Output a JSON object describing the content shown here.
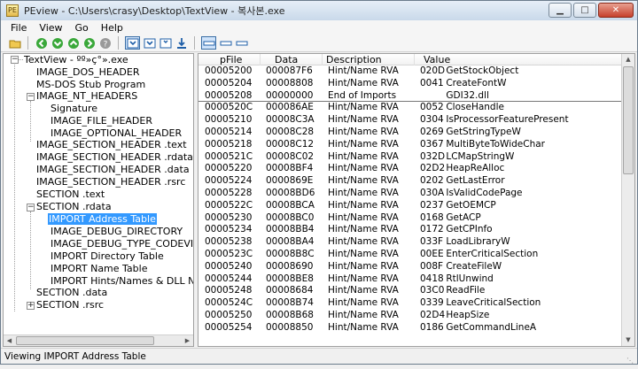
{
  "window": {
    "title": "PEview - C:\\Users\\crasy\\Desktop\\TextView - 복사본.exe"
  },
  "menu": [
    "File",
    "View",
    "Go",
    "Help"
  ],
  "toolbar": {
    "icons": [
      "open-icon",
      "back-icon",
      "forward-icon",
      "up-icon",
      "down-icon",
      "help-icon",
      "view-byte-icon",
      "view-word-icon",
      "view-dword-icon",
      "view-struct-icon",
      "layout-icon-1",
      "layout-icon-2",
      "layout-icon-3"
    ]
  },
  "tree": {
    "root": "TextView - ºº»ç°».exe",
    "items": [
      "IMAGE_DOS_HEADER",
      "MS-DOS Stub Program",
      "IMAGE_NT_HEADERS",
      "Signature",
      "IMAGE_FILE_HEADER",
      "IMAGE_OPTIONAL_HEADER",
      "IMAGE_SECTION_HEADER .text",
      "IMAGE_SECTION_HEADER .rdata",
      "IMAGE_SECTION_HEADER .data",
      "IMAGE_SECTION_HEADER .rsrc",
      "SECTION .text",
      "SECTION .rdata",
      "IMPORT Address Table",
      "IMAGE_DEBUG_DIRECTORY",
      "IMAGE_DEBUG_TYPE_CODEVIEW",
      "IMPORT Directory Table",
      "IMPORT Name Table",
      "IMPORT Hints/Names & DLL Names",
      "SECTION .data",
      "SECTION .rsrc"
    ],
    "selected": "IMPORT Address Table"
  },
  "list": {
    "headers": [
      "pFile",
      "Data",
      "Description",
      "Value"
    ],
    "rows": [
      {
        "pfile": "00005200",
        "data": "000087F6",
        "desc": "Hint/Name RVA",
        "hint": "020D",
        "value": "GetStockObject"
      },
      {
        "pfile": "00005204",
        "data": "00008808",
        "desc": "Hint/Name RVA",
        "hint": "0041",
        "value": "CreateFontW"
      },
      {
        "pfile": "00005208",
        "data": "00000000",
        "desc": "End of Imports",
        "hint": "",
        "value": "GDI32.dll"
      },
      {
        "pfile": "0000520C",
        "data": "000086AE",
        "desc": "Hint/Name RVA",
        "hint": "0052",
        "value": "CloseHandle"
      },
      {
        "pfile": "00005210",
        "data": "00008C3A",
        "desc": "Hint/Name RVA",
        "hint": "0304",
        "value": "IsProcessorFeaturePresent"
      },
      {
        "pfile": "00005214",
        "data": "00008C28",
        "desc": "Hint/Name RVA",
        "hint": "0269",
        "value": "GetStringTypeW"
      },
      {
        "pfile": "00005218",
        "data": "00008C12",
        "desc": "Hint/Name RVA",
        "hint": "0367",
        "value": "MultiByteToWideChar"
      },
      {
        "pfile": "0000521C",
        "data": "00008C02",
        "desc": "Hint/Name RVA",
        "hint": "032D",
        "value": "LCMapStringW"
      },
      {
        "pfile": "00005220",
        "data": "00008BF4",
        "desc": "Hint/Name RVA",
        "hint": "02D2",
        "value": "HeapReAlloc"
      },
      {
        "pfile": "00005224",
        "data": "0000869E",
        "desc": "Hint/Name RVA",
        "hint": "0202",
        "value": "GetLastError"
      },
      {
        "pfile": "00005228",
        "data": "00008BD6",
        "desc": "Hint/Name RVA",
        "hint": "030A",
        "value": "IsValidCodePage"
      },
      {
        "pfile": "0000522C",
        "data": "00008BCA",
        "desc": "Hint/Name RVA",
        "hint": "0237",
        "value": "GetOEMCP"
      },
      {
        "pfile": "00005230",
        "data": "00008BC0",
        "desc": "Hint/Name RVA",
        "hint": "0168",
        "value": "GetACP"
      },
      {
        "pfile": "00005234",
        "data": "00008BB4",
        "desc": "Hint/Name RVA",
        "hint": "0172",
        "value": "GetCPInfo"
      },
      {
        "pfile": "00005238",
        "data": "00008BA4",
        "desc": "Hint/Name RVA",
        "hint": "033F",
        "value": "LoadLibraryW"
      },
      {
        "pfile": "0000523C",
        "data": "00008B8C",
        "desc": "Hint/Name RVA",
        "hint": "00EE",
        "value": "EnterCriticalSection"
      },
      {
        "pfile": "00005240",
        "data": "00008690",
        "desc": "Hint/Name RVA",
        "hint": "008F",
        "value": "CreateFileW"
      },
      {
        "pfile": "00005244",
        "data": "00008BE8",
        "desc": "Hint/Name RVA",
        "hint": "0418",
        "value": "RtlUnwind"
      },
      {
        "pfile": "00005248",
        "data": "00008684",
        "desc": "Hint/Name RVA",
        "hint": "03C0",
        "value": "ReadFile"
      },
      {
        "pfile": "0000524C",
        "data": "00008B74",
        "desc": "Hint/Name RVA",
        "hint": "0339",
        "value": "LeaveCriticalSection"
      },
      {
        "pfile": "00005250",
        "data": "00008B68",
        "desc": "Hint/Name RVA",
        "hint": "02D4",
        "value": "HeapSize"
      },
      {
        "pfile": "00005254",
        "data": "00008850",
        "desc": "Hint/Name RVA",
        "hint": "0186",
        "value": "GetCommandLineA"
      }
    ]
  },
  "status": "Viewing IMPORT Address Table"
}
